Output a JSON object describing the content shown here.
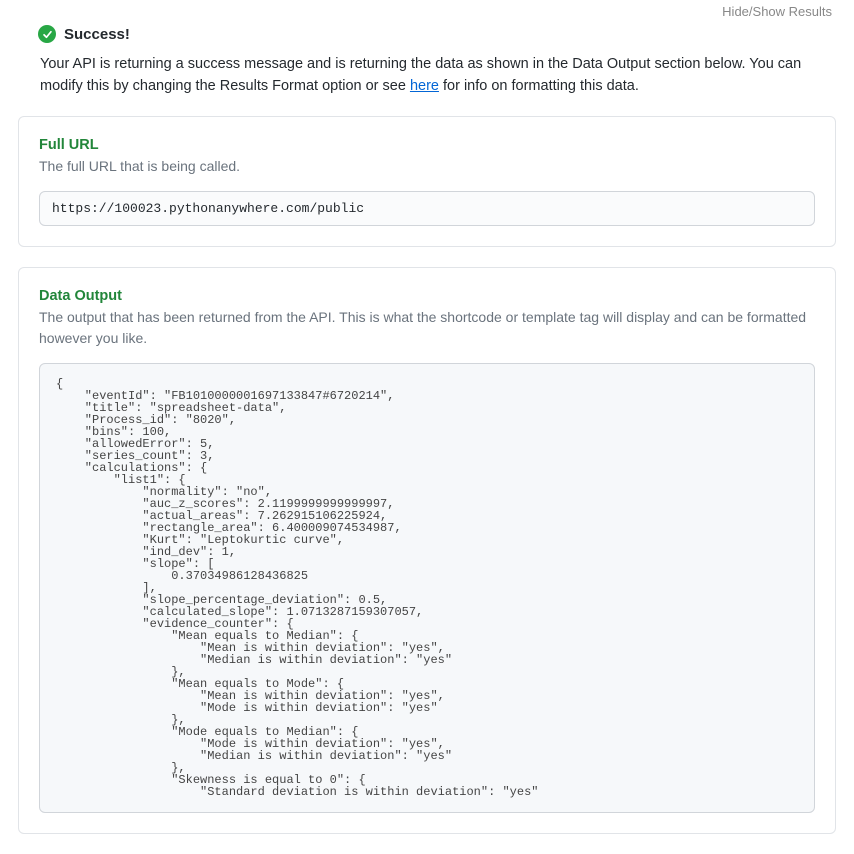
{
  "top": {
    "hideShow": "Hide/Show Results"
  },
  "success": {
    "title": "Success!",
    "msg_before": "Your API is returning a success message and is returning the data as shown in the Data Output section below. You can modify this by changing the Results Format option or see ",
    "link": "here",
    "msg_after": " for info on formatting this data."
  },
  "fullUrl": {
    "title": "Full URL",
    "desc": "The full URL that is being called.",
    "value": "https://100023.pythonanywhere.com/public"
  },
  "dataOutput": {
    "title": "Data Output",
    "desc": "The output that has been returned from the API. This is what the shortcode or template tag will display and can be formatted however you like.",
    "body": "{\n    \"eventId\": \"FB1010000001697133847#6720214\",\n    \"title\": \"spreadsheet-data\",\n    \"Process_id\": \"8020\",\n    \"bins\": 100,\n    \"allowedError\": 5,\n    \"series_count\": 3,\n    \"calculations\": {\n        \"list1\": {\n            \"normality\": \"no\",\n            \"auc_z_scores\": 2.1199999999999997,\n            \"actual_areas\": 7.262915106225924,\n            \"rectangle_area\": 6.400009074534987,\n            \"Kurt\": \"Leptokurtic curve\",\n            \"ind_dev\": 1,\n            \"slope\": [\n                0.37034986128436825\n            ],\n            \"slope_percentage_deviation\": 0.5,\n            \"calculated_slope\": 1.0713287159307057,\n            \"evidence_counter\": {\n                \"Mean equals to Median\": {\n                    \"Mean is within deviation\": \"yes\",\n                    \"Median is within deviation\": \"yes\"\n                },\n                \"Mean equals to Mode\": {\n                    \"Mean is within deviation\": \"yes\",\n                    \"Mode is within deviation\": \"yes\"\n                },\n                \"Mode equals to Median\": {\n                    \"Mode is within deviation\": \"yes\",\n                    \"Median is within deviation\": \"yes\"\n                },\n                \"Skewness is equal to 0\": {\n                    \"Standard deviation is within deviation\": \"yes\""
  }
}
